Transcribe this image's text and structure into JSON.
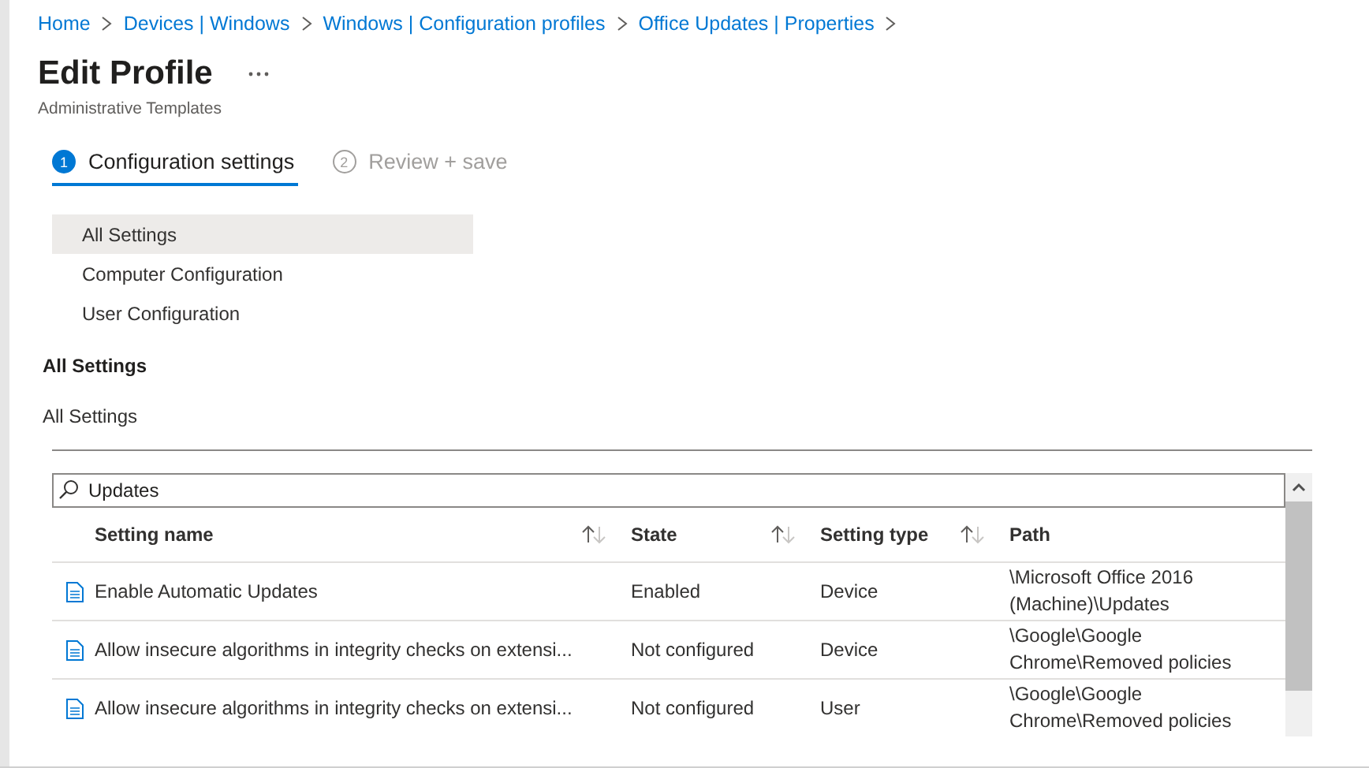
{
  "breadcrumb": [
    "Home",
    "Devices | Windows",
    "Windows | Configuration profiles",
    "Office Updates | Properties"
  ],
  "header": {
    "title": "Edit Profile",
    "subtitle": "Administrative Templates"
  },
  "steps": [
    {
      "number": "1",
      "label": "Configuration settings",
      "selected": true
    },
    {
      "number": "2",
      "label": "Review + save",
      "selected": false
    }
  ],
  "nav": {
    "items": [
      {
        "label": "All Settings",
        "selected": true
      },
      {
        "label": "Computer Configuration",
        "selected": false
      },
      {
        "label": "User Configuration",
        "selected": false
      }
    ]
  },
  "section": {
    "heading": "All Settings",
    "path": "All Settings"
  },
  "search": {
    "value": "Updates"
  },
  "table": {
    "columns": [
      {
        "label": "Setting name",
        "sortable": true
      },
      {
        "label": "State",
        "sortable": true
      },
      {
        "label": "Setting type",
        "sortable": true
      },
      {
        "label": "Path",
        "sortable": false
      }
    ],
    "rows": [
      {
        "name": "Enable Automatic Updates",
        "state": "Enabled",
        "type": "Device",
        "path": "\\Microsoft Office 2016 (Machine)\\Updates"
      },
      {
        "name": "Allow insecure algorithms in integrity checks on extensi...",
        "state": "Not configured",
        "type": "Device",
        "path": "\\Google\\Google Chrome\\Removed policies"
      },
      {
        "name": "Allow insecure algorithms in integrity checks on extensi...",
        "state": "Not configured",
        "type": "User",
        "path": "\\Google\\Google Chrome\\Removed policies"
      }
    ]
  }
}
